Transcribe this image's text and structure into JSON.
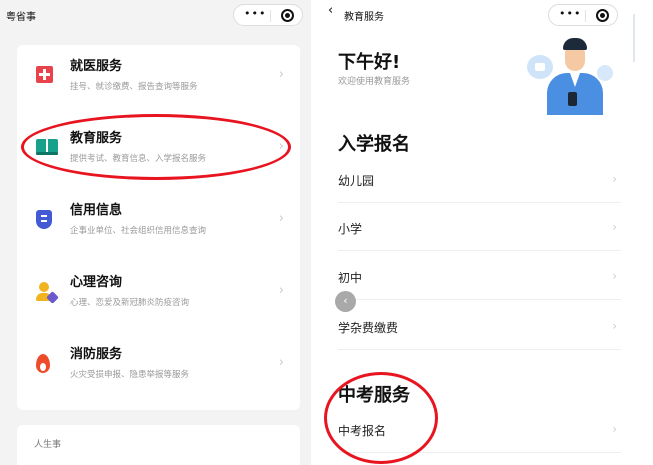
{
  "left": {
    "nav_title": "粤省事",
    "capsule": {
      "more": "•••",
      "close_icon": "target-icon"
    },
    "services": [
      {
        "title": "就医服务",
        "desc": "挂号、就诊缴费、报告查询等服务",
        "icon": "medical-cross-icon",
        "color": "#e8424b"
      },
      {
        "title": "教育服务",
        "desc": "提供考试、教育信息、入学报名服务",
        "icon": "book-icon",
        "color": "#17a18b"
      },
      {
        "title": "信用信息",
        "desc": "企事业单位、社会组织信用信息查询",
        "icon": "shield-icon",
        "color": "#4459d4"
      },
      {
        "title": "心理咨询",
        "desc": "心理、恋爱及新冠肺炎防疫咨询",
        "icon": "person-heart-icon",
        "color": "#f2b320"
      },
      {
        "title": "消防服务",
        "desc": "火灾受损申报、隐患举报等服务",
        "icon": "flame-icon",
        "color": "#ee4b2b"
      }
    ],
    "chevron": "›",
    "section_label": "人生事"
  },
  "right": {
    "back": "‹",
    "nav_title": "教育服务",
    "greeting": "下午好!",
    "welcome": "欢迎使用教育服务",
    "enroll_title": "入学报名",
    "enroll_items": [
      "幼儿园",
      "小学",
      "初中",
      "学杂费缴费"
    ],
    "exam_title": "中考服务",
    "exam_items": [
      "中考报名"
    ],
    "chevron": "›",
    "float_back": "‹"
  },
  "highlight_color": "#e8141f"
}
